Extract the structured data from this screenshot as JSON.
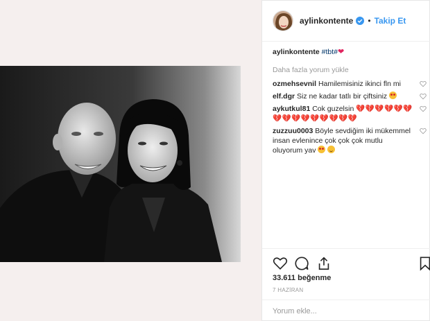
{
  "post": {
    "username": "aylinkontente",
    "follow_label": "Takip Et",
    "dot": "•",
    "caption_user": "aylinkontente",
    "caption_tag": "#tbt",
    "caption_suffix": "#",
    "load_more": "Daha fazla yorum yükle",
    "likes": "33.611 beğenme",
    "date": "7 HAZİRAN",
    "add_comment_placeholder": "Yorum ekle..."
  },
  "comments": [
    {
      "user": "ozmehsevnil",
      "text": "Hamilemisiniz ikinci fln mi"
    },
    {
      "user": "elf.dgr",
      "text": "Siz ne kadar tatlı bir çiftsiniz"
    },
    {
      "user": "aykutkul81",
      "text": "Cok guzelsin"
    },
    {
      "user": "zuzzuu0003",
      "text": "Böyle sevdiğim iki mükemmel insan evlenince çok çok çok mutlu oluyorum yav"
    }
  ],
  "icons": {
    "verified": "verified-badge-icon",
    "like": "heart-icon",
    "comment": "comment-icon",
    "share": "share-icon",
    "save": "bookmark-icon"
  },
  "colors": {
    "link": "#3897f0",
    "muted": "#999999",
    "heart": "#e0245e",
    "photo_bg": "#f5efee"
  }
}
